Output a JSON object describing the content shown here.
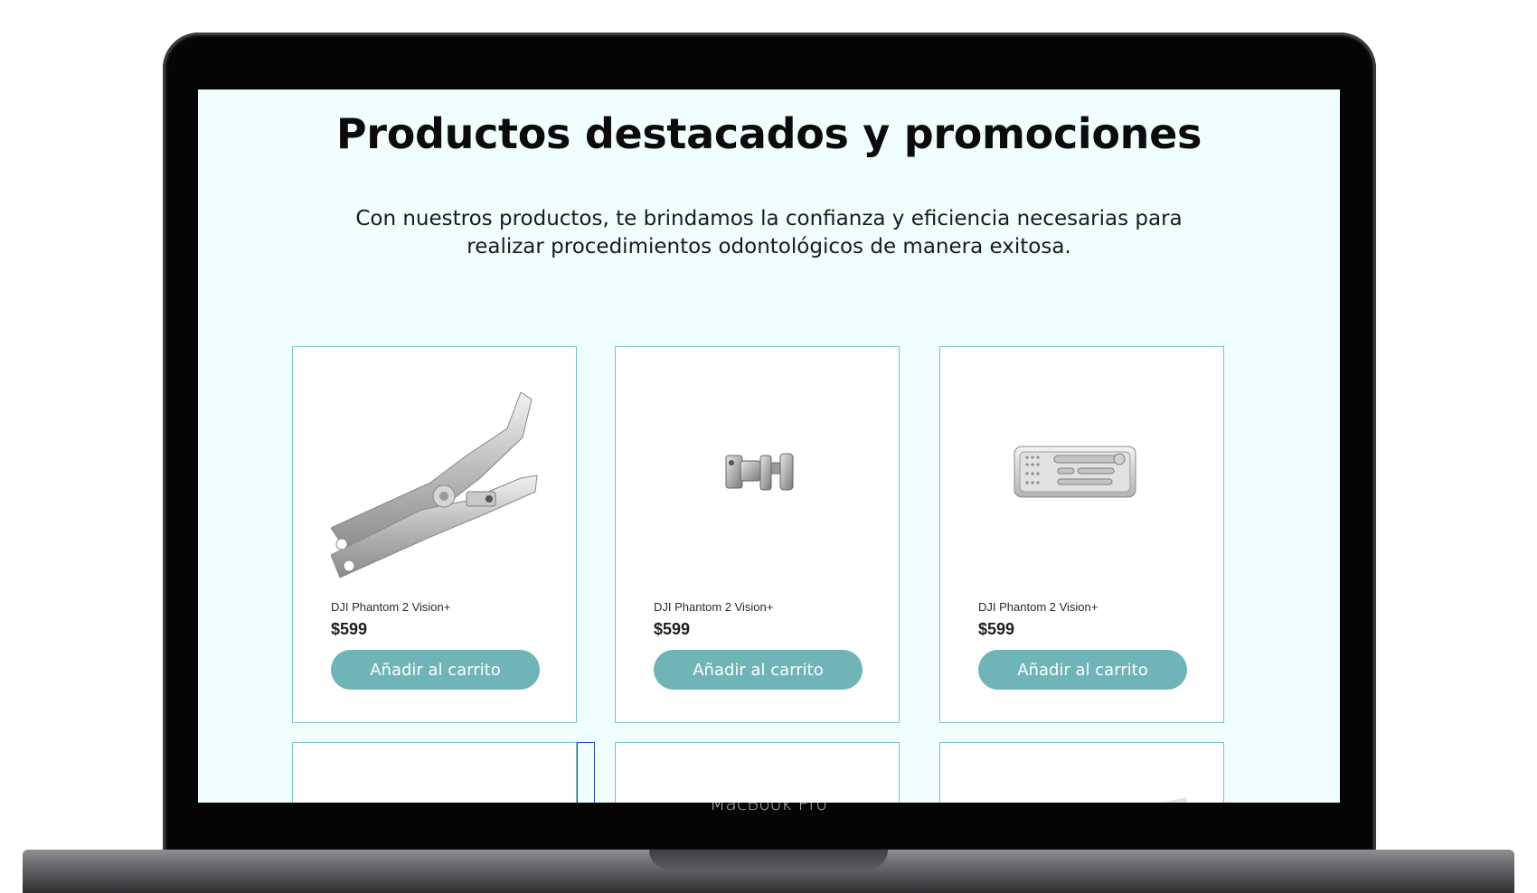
{
  "device": {
    "label": "MacBook Pro"
  },
  "section": {
    "title": "Productos destacados y promociones",
    "subtitle": "Con nuestros productos, te brindamos la confianza y eficiencia necesarias para realizar procedimientos odontológicos de manera exitosa."
  },
  "products": [
    {
      "name": "DJI Phantom 2 Vision+",
      "price": "$599",
      "button": "Añadir al carrito",
      "image": "dental-pliers"
    },
    {
      "name": "DJI Phantom 2 Vision+",
      "price": "$599",
      "button": "Añadir al carrito",
      "image": "orthodontic-brackets"
    },
    {
      "name": "DJI Phantom 2 Vision+",
      "price": "$599",
      "button": "Añadir al carrito",
      "image": "instrument-tray"
    }
  ],
  "colors": {
    "page_background": "#f0fefe",
    "card_border": "#7cc3c8",
    "button_background": "#6fb4b6",
    "button_text": "#ffffff"
  }
}
